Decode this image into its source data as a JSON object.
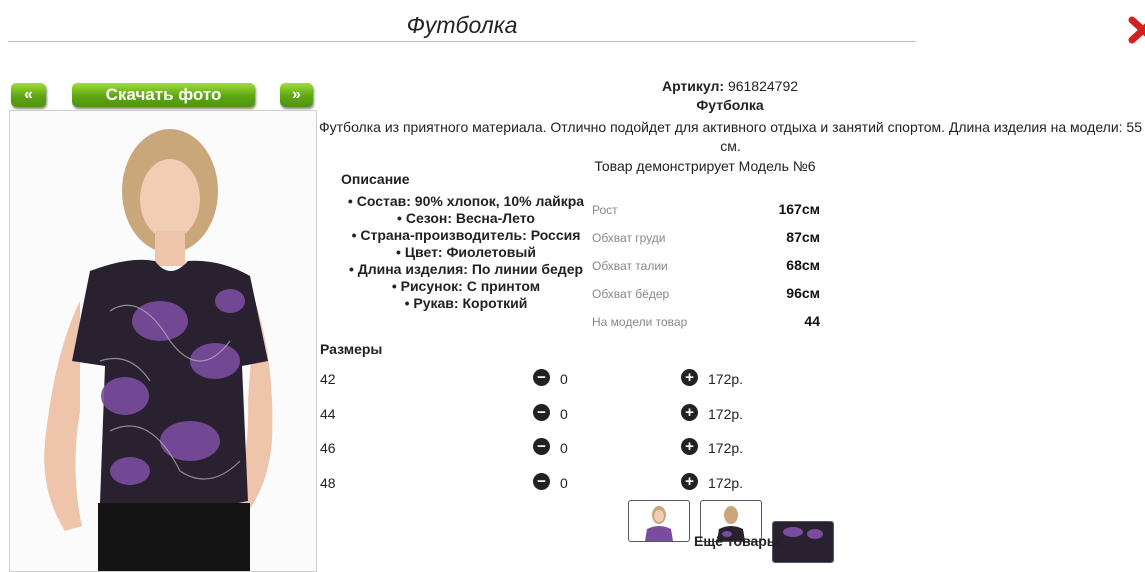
{
  "header": {
    "title": "Футболка"
  },
  "nav": {
    "prev": "«",
    "download": "Скачать фото",
    "next": "»"
  },
  "product": {
    "article_label": "Артикул:",
    "article_value": "961824792",
    "name": "Футболка",
    "description": "Футболка из приятного материала. Отлично подойдет для активного отдыха и занятий спортом. Длина изделия на модели: 55 см.",
    "model_demo": "Товар демонстрирует Модель №6"
  },
  "specs": {
    "heading": "Описание",
    "items": [
      "Состав: 90% хлопок, 10% лайкра",
      "Сезон: Весна-Лето",
      "Страна-производитель: Россия",
      "Цвет: Фиолетовый",
      "Длина изделия: По линии бедер",
      "Рисунок: С принтом",
      "Рукав: Короткий"
    ]
  },
  "model": [
    {
      "label": "Рост",
      "value": "167см"
    },
    {
      "label": "Обхват груди",
      "value": "87см"
    },
    {
      "label": "Обхват талии",
      "value": "68см"
    },
    {
      "label": "Обхват бёдер",
      "value": "96см"
    },
    {
      "label": "На модели товар",
      "value": "44"
    }
  ],
  "sizes": {
    "heading": "Размеры",
    "rows": [
      {
        "size": "42",
        "qty": "0",
        "price": "172р."
      },
      {
        "size": "44",
        "qty": "0",
        "price": "172р."
      },
      {
        "size": "46",
        "qty": "0",
        "price": "172р."
      },
      {
        "size": "48",
        "qty": "0",
        "price": "172р."
      }
    ]
  },
  "footer": {
    "more": "Ещё товары:"
  },
  "colors": {
    "accent_green": "#5ea612",
    "shirt_purple": "#7a4c9e",
    "close_red": "#d61f1f"
  }
}
